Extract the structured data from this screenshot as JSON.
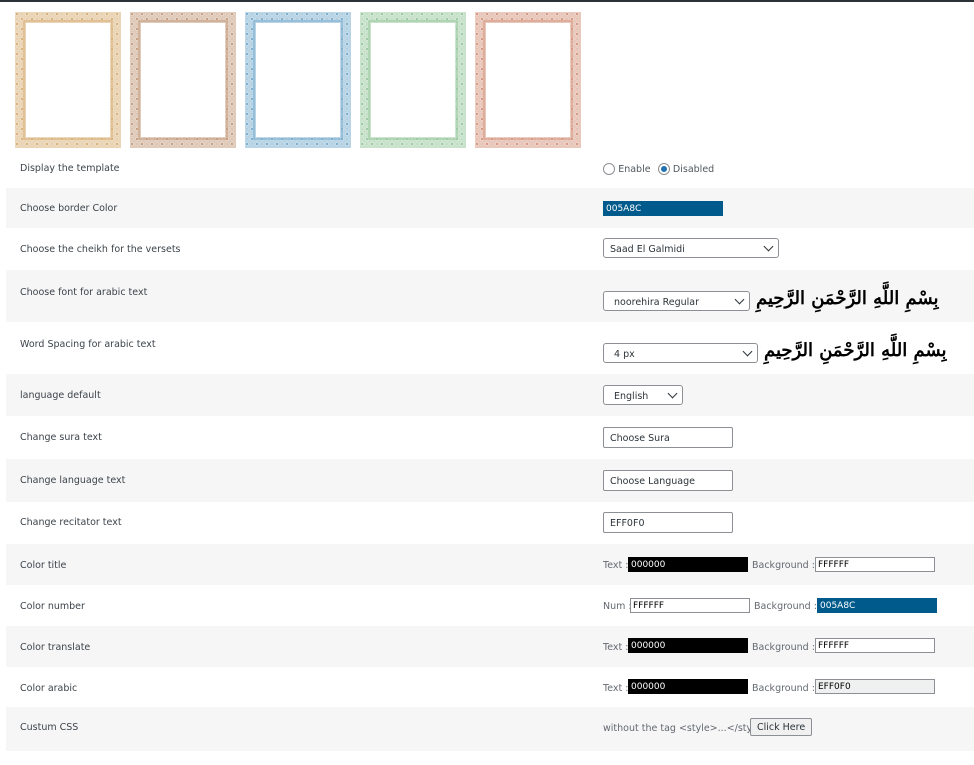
{
  "frames": [
    {
      "color": "#d9b27c",
      "name": "frame-gold"
    },
    {
      "color": "#c6a184",
      "name": "frame-brown"
    },
    {
      "color": "#7fb0cf",
      "name": "frame-blue"
    },
    {
      "color": "#9ccaa2",
      "name": "frame-green"
    },
    {
      "color": "#d79a85",
      "name": "frame-rose"
    }
  ],
  "display_template": {
    "label": "Display the template",
    "enable_label": "Enable",
    "disabled_label": "Disabled",
    "selected": "Disabled"
  },
  "border_color": {
    "label": "Choose border Color",
    "value": "005A8C",
    "swatch": "#005a8c"
  },
  "cheikh": {
    "label": "Choose the cheikh for the versets",
    "value": "Saad El Galmidi"
  },
  "arabic_font": {
    "label": "Choose font for arabic text",
    "value": "noorehira Regular",
    "preview": "بِسْمِ اللَّهِ الرَّحْمَنِ الرَّحِيمِ"
  },
  "word_spacing": {
    "label": "Word Spacing for arabic text",
    "value": "4 px",
    "preview": "بِسْمِ اللَّهِ الرَّحْمَنِ الرَّحِيمِ"
  },
  "language_default": {
    "label": "language default",
    "value": "English"
  },
  "sura_text": {
    "label": "Change sura text",
    "value": "Choose Sura"
  },
  "language_text": {
    "label": "Change language text",
    "value": "Choose Language"
  },
  "recitator_text": {
    "label": "Change recitator text",
    "value": "EFF0F0"
  },
  "color_title": {
    "label": "Color title",
    "text_label": "Text :",
    "text_value": "000000",
    "text_bg": "#000000",
    "text_fg": "#ffffff",
    "bg_label": "Background :",
    "bg_value": "FFFFFF",
    "bg_bg": "#ffffff",
    "bg_fg": "#000000"
  },
  "color_number": {
    "label": "Color number",
    "text_label": "Num :",
    "text_value": "FFFFFF",
    "text_bg": "#ffffff",
    "text_fg": "#000000",
    "bg_label": "Background :",
    "bg_value": "005A8C",
    "bg_bg": "#005a8c",
    "bg_fg": "#ffffff"
  },
  "color_translate": {
    "label": "Color translate",
    "text_label": "Text :",
    "text_value": "000000",
    "text_bg": "#000000",
    "text_fg": "#ffffff",
    "bg_label": "Background :",
    "bg_value": "FFFFFF",
    "bg_bg": "#ffffff",
    "bg_fg": "#000000"
  },
  "color_arabic": {
    "label": "Color arabic",
    "text_label": "Text :",
    "text_value": "000000",
    "text_bg": "#000000",
    "text_fg": "#ffffff",
    "bg_label": "Background :",
    "bg_value": "EFF0F0",
    "bg_bg": "#eff0f0",
    "bg_fg": "#000000"
  },
  "custom_css": {
    "label": "Custum CSS",
    "hint": "without the tag <style>...</style>",
    "button": "Click Here"
  }
}
